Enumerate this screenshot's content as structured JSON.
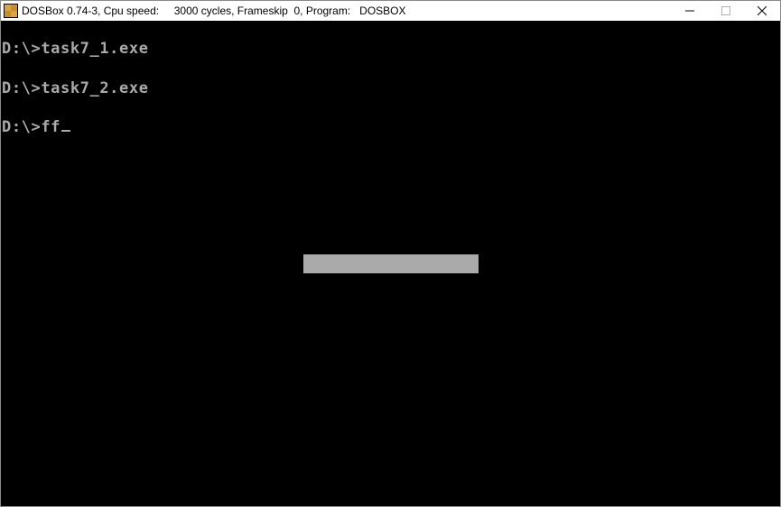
{
  "window": {
    "title": "DOSBox 0.74-3, Cpu speed:     3000 cycles, Frameskip  0, Program:   DOSBOX",
    "app_icon": "dosbox-icon",
    "controls": {
      "minimize_icon": "minimize-icon",
      "maximize_icon": "maximize-icon",
      "close_icon": "close-icon"
    }
  },
  "console": {
    "background": "#000000",
    "text_color": "#aaaaaa",
    "lines": [
      "D:\\>task7_1.exe",
      "D:\\>task7_2.exe",
      "D:\\>ff"
    ],
    "cursor": "_",
    "bar_color": "#aaaaaa"
  }
}
